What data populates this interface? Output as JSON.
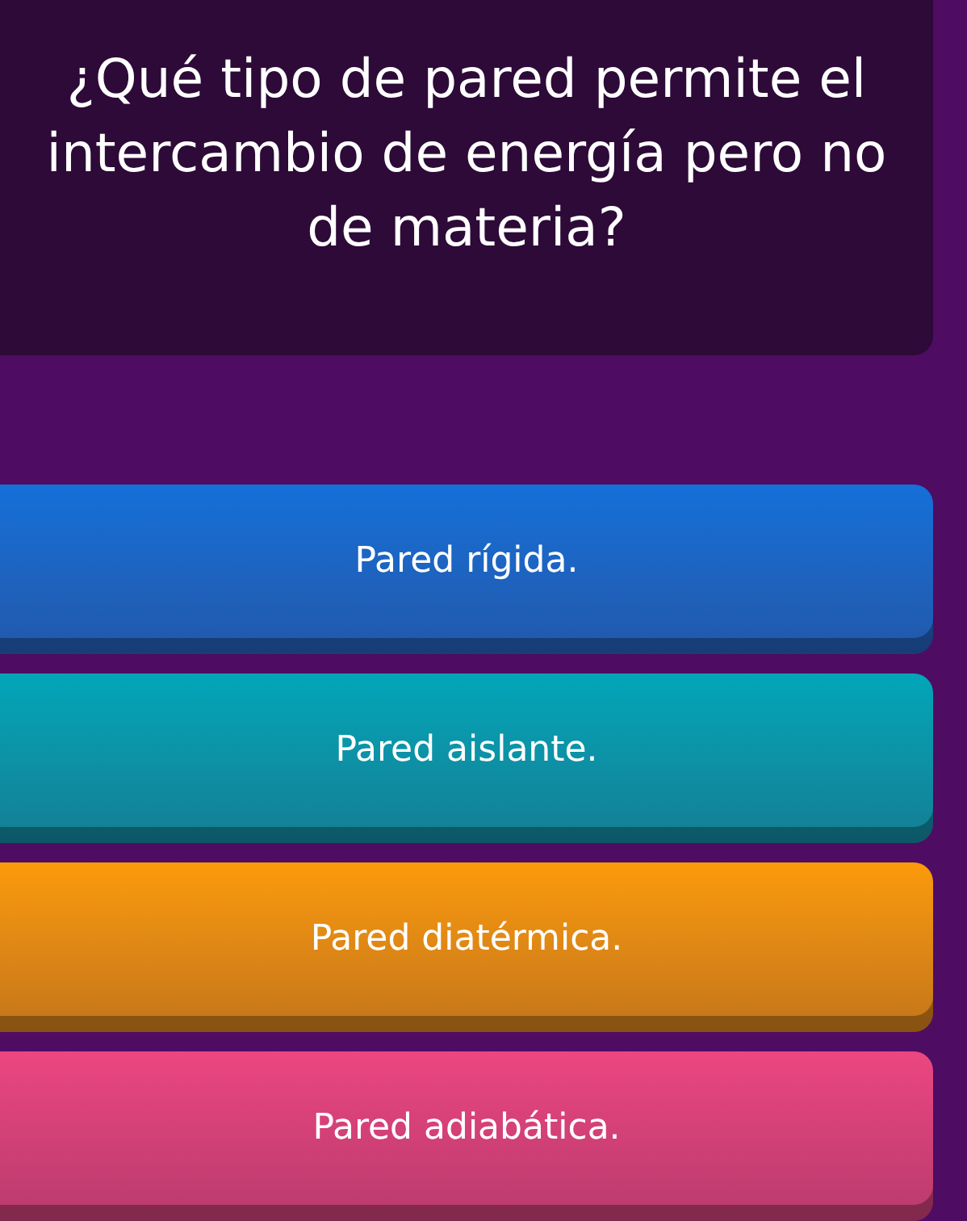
{
  "question": "¿Qué tipo de pared permite el intercambio de energía pero no de materia?",
  "options": [
    {
      "label": "Pared rígida.",
      "color": "#1470d8"
    },
    {
      "label": "Pared aislante.",
      "color": "#00a6b8"
    },
    {
      "label": "Pared diatérmica.",
      "color": "#fb9a0a"
    },
    {
      "label": "Pared adiabática.",
      "color": "#ec4680"
    }
  ]
}
